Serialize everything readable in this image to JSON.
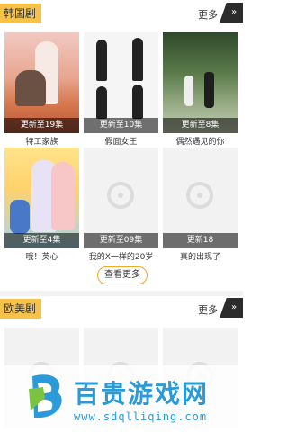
{
  "sections": {
    "korean": {
      "title": "韩国剧",
      "more_label": "更多",
      "arrow_glyph": "»",
      "items": [
        {
          "badge": "更新至19集",
          "title": "特工家族"
        },
        {
          "badge": "更新至10集",
          "title": "假面女王"
        },
        {
          "badge": "更新至8集",
          "title": "偶然遇见的你"
        },
        {
          "badge": "更新至4集",
          "title": "哦！英心"
        },
        {
          "badge": "更新至09集",
          "title": "我的X一样的20岁"
        },
        {
          "badge": "更新18",
          "title": "真的出现了"
        }
      ],
      "see_more_label": "查看更多"
    },
    "western": {
      "title": "欧美剧",
      "more_label": "更多",
      "arrow_glyph": "»"
    }
  },
  "watermark": {
    "title": "百贵游戏网",
    "url": "www.sdqlliqing.com"
  },
  "colors": {
    "accent": "#f6c24a",
    "dark_tab": "#2c2c2c",
    "watermark_blue": "#2b9ad8"
  }
}
